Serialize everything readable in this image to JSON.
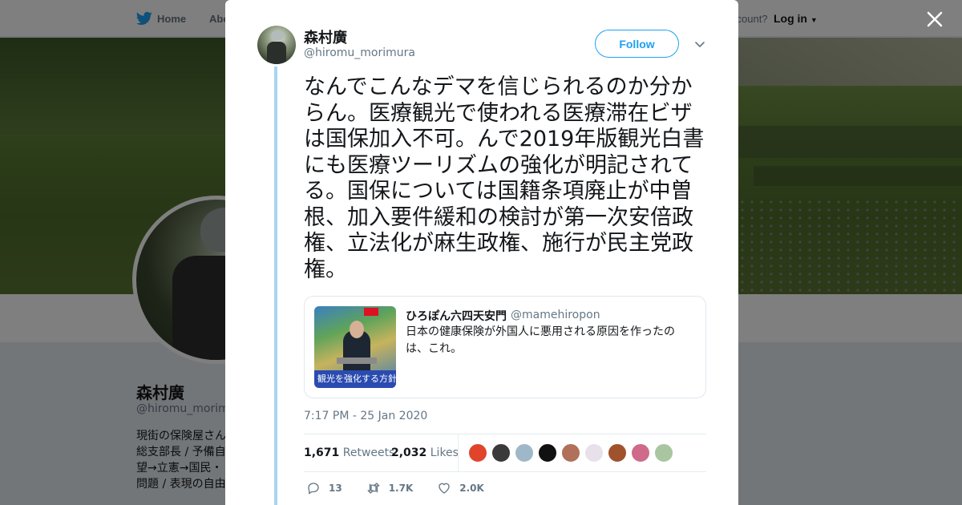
{
  "nav": {
    "home_label": "Home",
    "about_label": "Abo",
    "account_text": "ccount?",
    "login_label": "Log in"
  },
  "profile_bg": {
    "name": "森村廣",
    "handle": "@hiromu_morimu",
    "bio_lines": [
      "現街の保険屋さん",
      "総支部長 / 予備自",
      "望→立憲→国民・",
      "問題 / 表現の自由"
    ]
  },
  "tweet": {
    "author_name": "森村廣",
    "author_handle": "@hiromu_morimura",
    "follow_label": "Follow",
    "text": "なんでこんなデマを信じられるのか分からん。医療観光で使われる医療滞在ビザは国保加入不可。んで2019年版観光白書にも医療ツーリズムの強化が明記されてる。国保については国籍条項廃止が中曽根、加入要件緩和の検討が第一次安倍政権、立法化が麻生政権、施行が民主党政権。",
    "quote": {
      "author_name": "ひろぽん六四天安門",
      "author_handle": "@mamehiropon",
      "text": "日本の健康保険が外国人に悪用される原因を作ったのは、これ。",
      "image_caption": "観光を強化する方針を"
    },
    "timestamp": "7:17 PM - 25 Jan 2020",
    "retweets_count": "1,671",
    "retweets_label": "Retweets",
    "likes_count": "2,032",
    "likes_label": "Likes",
    "liker_colors": [
      "#e0452b",
      "#3a3a3a",
      "#9fb8c9",
      "#111111",
      "#b0705a",
      "#e8e0ea",
      "#a0522d",
      "#d06a8a",
      "#a9c6a0"
    ],
    "actions": {
      "reply_count": "13",
      "retweet_count": "1.7K",
      "like_count": "2.0K"
    }
  },
  "colors": {
    "accent": "#1da1f2",
    "thread_line": "#aad4f0",
    "text_primary": "#14171a",
    "text_secondary": "#657786"
  }
}
